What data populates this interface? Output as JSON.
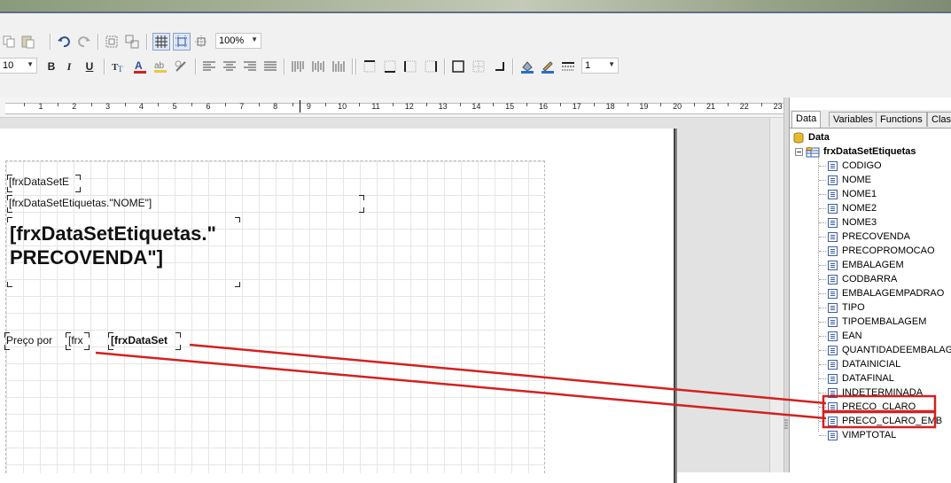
{
  "toolbar": {
    "zoom": "100%",
    "font_size": "10",
    "line_width": "1",
    "bold_label": "B",
    "italic_label": "I",
    "underline_label": "U"
  },
  "ruler": {
    "numbers": [
      "1",
      "2",
      "3",
      "4",
      "5",
      "6",
      "7",
      "8",
      "9",
      "10",
      "11",
      "12",
      "13",
      "14",
      "15",
      "16",
      "17",
      "18",
      "19",
      "20",
      "21",
      "22",
      "23"
    ]
  },
  "report": {
    "memo_short": "[frxDataSetE",
    "memo_nome": "[frxDataSetEtiquetas.\"NOME\"]",
    "memo_preco_line1": "[frxDataSetEtiquetas.\"",
    "memo_preco_line2": "PRECOVENDA\"]",
    "label_preco_por": "Preço  por",
    "memo_frx": "[frx",
    "memo_frxdataset": "[frxDataSet"
  },
  "data_panel": {
    "tabs": [
      "Data",
      "Variables",
      "Functions",
      "Clas"
    ],
    "active_tab": "Data",
    "root": "Data",
    "dataset": "frxDataSetEtiquetas",
    "fields": [
      "CODIGO",
      "NOME",
      "NOME1",
      "NOME2",
      "NOME3",
      "PRECOVENDA",
      "PRECOPROMOCAO",
      "EMBALAGEM",
      "CODBARRA",
      "EMBALAGEMPADRAO",
      "TIPO",
      "TIPOEMBALAGEM",
      "EAN",
      "QUANTIDADEEMBALAGEM",
      "DATAINICIAL",
      "DATAFINAL",
      "INDETERMINADA",
      "PRECO_CLARO",
      "PRECO_CLARO_EMB",
      "VIMPTOTAL"
    ],
    "highlighted_fields": [
      "PRECO_CLARO",
      "PRECO_CLARO_EMB"
    ]
  },
  "colors": {
    "annotation_red": "#d42020",
    "field_icon_blue": "#3c5ea8",
    "toolbar_bg": "#f1f1f1"
  }
}
